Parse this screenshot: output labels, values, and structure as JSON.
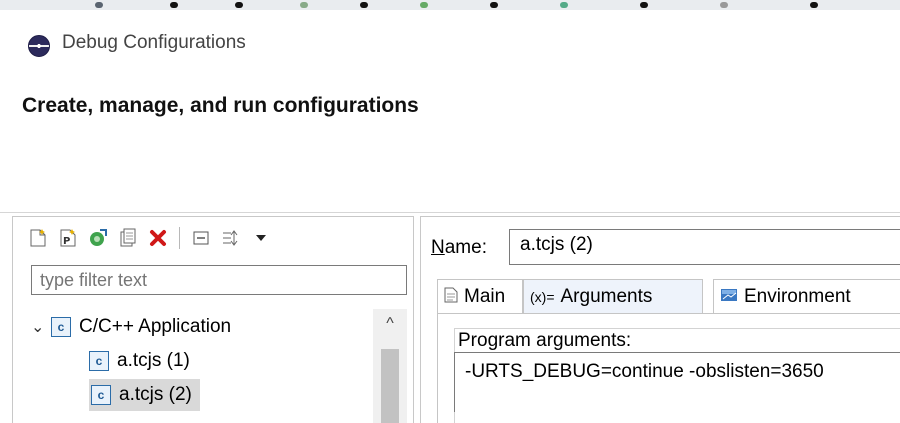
{
  "window": {
    "title": "Debug Configurations"
  },
  "banner": {
    "title": "Create, manage, and run configurations"
  },
  "toolbar": {
    "icons": [
      "new-configuration-icon",
      "new-prototype-icon",
      "export-icon",
      "duplicate-icon",
      "delete-icon",
      "collapse-all-icon",
      "filter-icon",
      "dropdown-arrow-icon"
    ]
  },
  "filter": {
    "placeholder": "type filter text"
  },
  "tree": {
    "category": {
      "label": "C/C++ Application",
      "icon_text": "c"
    },
    "items": [
      {
        "label": "a.tcjs (1)",
        "icon_text": "c",
        "selected": false
      },
      {
        "label": "a.tcjs (2)",
        "icon_text": "c",
        "selected": true
      }
    ]
  },
  "name": {
    "label_underlined": "N",
    "label_rest": "ame:",
    "value": "a.tcjs (2)"
  },
  "tabs": [
    {
      "label": "Main",
      "icon": "page-icon",
      "glyph": ""
    },
    {
      "label": "Arguments",
      "icon": "variables-icon",
      "glyph": "(x)=",
      "active": true
    },
    {
      "label": "Environment",
      "icon": "environment-icon",
      "glyph": ""
    }
  ],
  "program_args": {
    "label": "Program arguments:",
    "value": "-URTS_DEBUG=continue -obslisten=3650"
  },
  "colors": {
    "accent": "#2b6ca8",
    "delete_red": "#d01818",
    "selection": "#d9d9d9"
  }
}
